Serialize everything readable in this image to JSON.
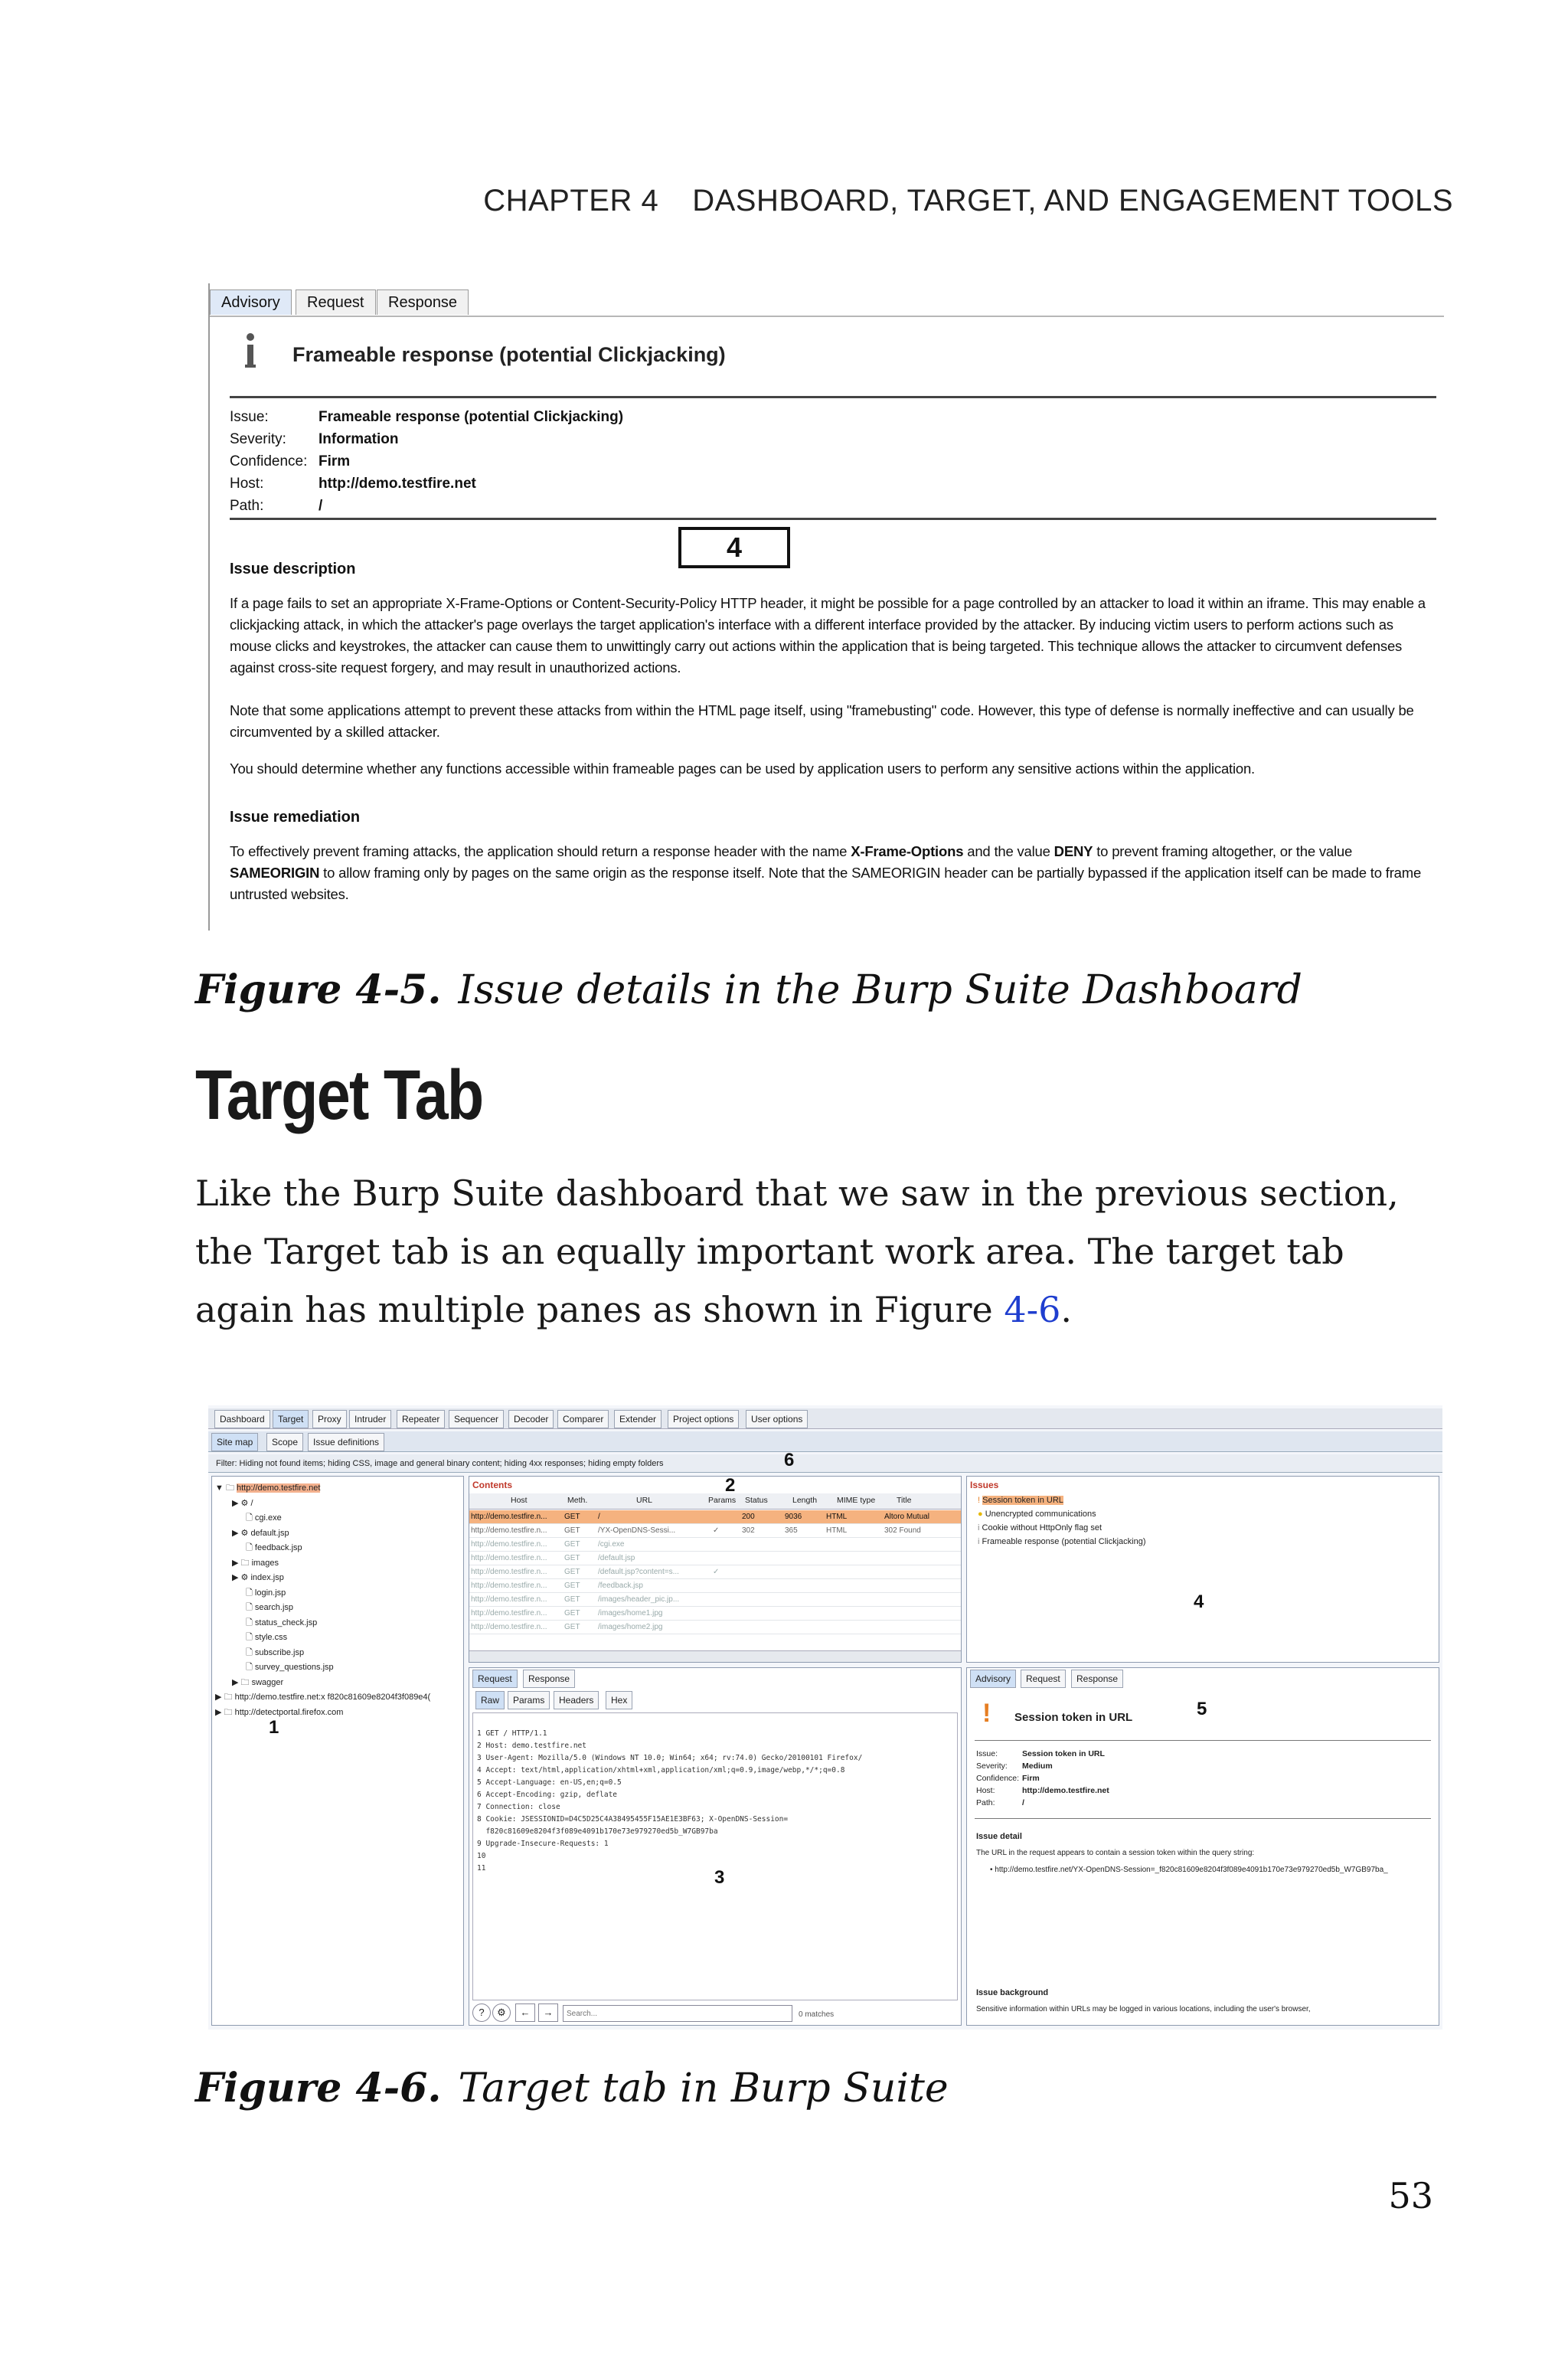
{
  "header": {
    "chapter": "CHAPTER 4",
    "title": "DASHBOARD, TARGET, AND ENGAGEMENT TOOLS"
  },
  "figure5": {
    "tabs": [
      "Advisory",
      "Request",
      "Response"
    ],
    "title": "Frameable response (potential Clickjacking)",
    "fields": [
      {
        "key": "Issue:",
        "value": "Frameable response (potential Clickjacking)"
      },
      {
        "key": "Severity:",
        "value": "Information"
      },
      {
        "key": "Confidence:",
        "value": "Firm"
      },
      {
        "key": "Host:",
        "value": "http://demo.testfire.net"
      },
      {
        "key": "Path:",
        "value": "/"
      }
    ],
    "callout": "4",
    "issue_description_heading": "Issue description",
    "issue_description": [
      "If a page fails to set an appropriate X-Frame-Options or Content-Security-Policy HTTP header, it might be possible for a page controlled by an attacker to load it within an iframe. This may enable a clickjacking attack, in which the attacker's page overlays the target application's interface with a different interface provided by the attacker. By inducing victim users to perform actions such as mouse clicks and keystrokes, the attacker can cause them to unwittingly carry out actions within the application that is being targeted. This technique allows the attacker to circumvent defenses against cross-site request forgery, and may result in unauthorized actions.",
      "Note that some applications attempt to prevent these attacks from within the HTML page itself, using \"framebusting\" code. However, this type of defense is normally ineffective and can usually be circumvented by a skilled attacker.",
      "You should determine whether any functions accessible within frameable pages can be used by application users to perform any sensitive actions within the application."
    ],
    "issue_remediation_heading": "Issue remediation",
    "remediation": {
      "p1": "To effectively prevent framing attacks, the application should return a response header with the name ",
      "b1": "X-Frame-Options",
      "p2": " and the value ",
      "b2": "DENY",
      "p3": " to prevent framing altogether, or the value ",
      "b3": "SAMEORIGIN",
      "p4": " to allow framing only by pages on the same origin as the response itself. Note that the SAMEORIGIN header can be partially bypassed if the application itself can be made to frame untrusted websites."
    }
  },
  "caption5": {
    "label": "Figure 4-5.",
    "text": "Issue details in the Burp Suite Dashboard"
  },
  "section_heading": "Target Tab",
  "body": {
    "text": "Like the Burp Suite dashboard that we saw in the previous section, the Target tab is an equally important work area. The target tab again has multiple panes as shown in Figure ",
    "link": "4-6",
    "end": "."
  },
  "figure6": {
    "main_tabs": [
      "Dashboard",
      "Target",
      "Proxy",
      "Intruder",
      "Repeater",
      "Sequencer",
      "Decoder",
      "Comparer",
      "Extender",
      "Project options",
      "User options"
    ],
    "sub_tabs": [
      "Site map",
      "Scope",
      "Issue definitions"
    ],
    "filter": "Filter: Hiding not found items; hiding CSS, image and general binary content; hiding 4xx responses; hiding empty folders",
    "tree": [
      "http://demo.testfire.net",
      "/",
      "cgi.exe",
      "default.jsp",
      "feedback.jsp",
      "images",
      "index.jsp",
      "login.jsp",
      "search.jsp",
      "status_check.jsp",
      "style.css",
      "subscribe.jsp",
      "survey_questions.jsp",
      "swagger",
      "http://demo.testfire.net:x f820c81609e8204f3f089e4(",
      "http://detectportal.firefox.com"
    ],
    "contents_label": "Contents",
    "columns": [
      "Host",
      "Meth.",
      "URL",
      "Params",
      "Status",
      "Length",
      "MIME type",
      "Title"
    ],
    "rows": [
      [
        "http://demo.testfire.n...",
        "GET",
        "/",
        "",
        "200",
        "9036",
        "HTML",
        "Altoro Mutual"
      ],
      [
        "http://demo.testfire.n...",
        "GET",
        "/YX-OpenDNS-Sessi...",
        "✓",
        "302",
        "365",
        "HTML",
        "302 Found"
      ],
      [
        "http://demo.testfire.n...",
        "GET",
        "/cgi.exe",
        "",
        "",
        "",
        "",
        ""
      ],
      [
        "http://demo.testfire.n...",
        "GET",
        "/default.jsp",
        "",
        "",
        "",
        "",
        ""
      ],
      [
        "http://demo.testfire.n...",
        "GET",
        "/default.jsp?content=s...",
        "✓",
        "",
        "",
        "",
        ""
      ],
      [
        "http://demo.testfire.n...",
        "GET",
        "/feedback.jsp",
        "",
        "",
        "",
        "",
        ""
      ],
      [
        "http://demo.testfire.n...",
        "GET",
        "/images/header_pic.jp...",
        "",
        "",
        "",
        "",
        ""
      ],
      [
        "http://demo.testfire.n...",
        "GET",
        "/images/home1.jpg",
        "",
        "",
        "",
        "",
        ""
      ],
      [
        "http://demo.testfire.n...",
        "GET",
        "/images/home2.jpg",
        "",
        "",
        "",
        "",
        ""
      ]
    ],
    "issues_label": "Issues",
    "issues": [
      "Session token in URL",
      "Unencrypted communications",
      "Cookie without HttpOnly flag set",
      "Frameable response (potential Clickjacking)"
    ],
    "req_tabs": [
      "Request",
      "Response"
    ],
    "raw_tabs": [
      "Raw",
      "Params",
      "Headers",
      "Hex"
    ],
    "request_lines": "1 GET / HTTP/1.1\n2 Host: demo.testfire.net\n3 User-Agent: Mozilla/5.0 (Windows NT 10.0; Win64; x64; rv:74.0) Gecko/20100101 Firefox/\n4 Accept: text/html,application/xhtml+xml,application/xml;q=0.9,image/webp,*/*;q=0.8\n5 Accept-Language: en-US,en;q=0.5\n6 Accept-Encoding: gzip, deflate\n7 Connection: close\n8 Cookie: JSESSIONID=D4C5D25C4A38495455F15AE1E3BF63; X-OpenDNS-Session=\n  f820c81609e8204f3f089e4091b170e73e979270ed5b_W7GB97ba\n9 Upgrade-Insecure-Requests: 1\n10\n11",
    "search_placeholder": "Search...",
    "matches": "0 matches",
    "adv_tabs": [
      "Advisory",
      "Request",
      "Response"
    ],
    "adv_title": "Session token in URL",
    "adv_fields": [
      {
        "key": "Issue:",
        "value": "Session token in URL"
      },
      {
        "key": "Severity:",
        "value": "Medium"
      },
      {
        "key": "Confidence:",
        "value": "Firm"
      },
      {
        "key": "Host:",
        "value": "http://demo.testfire.net"
      },
      {
        "key": "Path:",
        "value": "/"
      }
    ],
    "issue_detail_heading": "Issue detail",
    "issue_detail": "The URL in the request appears to contain a session token within the query string:",
    "issue_detail_url": "http://demo.testfire.net/YX-OpenDNS-Session=_f820c81609e8204f3f089e4091b170e73e979270ed5b_W7GB97ba_",
    "issue_background_heading": "Issue background",
    "issue_background": "Sensitive information within URLs may be logged in various locations, including the user's browser,",
    "pane_numbers": [
      "1",
      "2",
      "3",
      "4",
      "5",
      "6"
    ]
  },
  "caption6": {
    "label": "Figure 4-6.",
    "text": "Target tab in Burp Suite"
  },
  "page_number": "53"
}
